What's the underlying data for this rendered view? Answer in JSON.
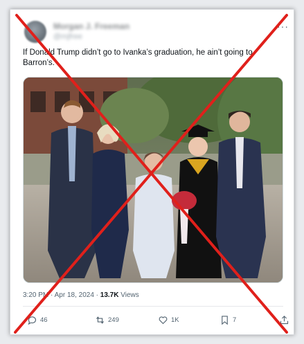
{
  "post": {
    "display_name": "Morgan J. Freeman",
    "handle": "@mjfree",
    "text": "If Donald Trump didn’t go to Ivanka’s graduation, he ain’t going to Barron’s.",
    "time": "3:20 PM",
    "separator": "·",
    "date": "Apr 18, 2024",
    "views_count": "13.7K",
    "views_label": "Views"
  },
  "actions": {
    "replies": "46",
    "reposts": "249",
    "likes": "1K",
    "bookmarks": "7"
  },
  "colors": {
    "overlay_x": "#e0201b",
    "text": "#0f1419",
    "muted": "#536471"
  }
}
